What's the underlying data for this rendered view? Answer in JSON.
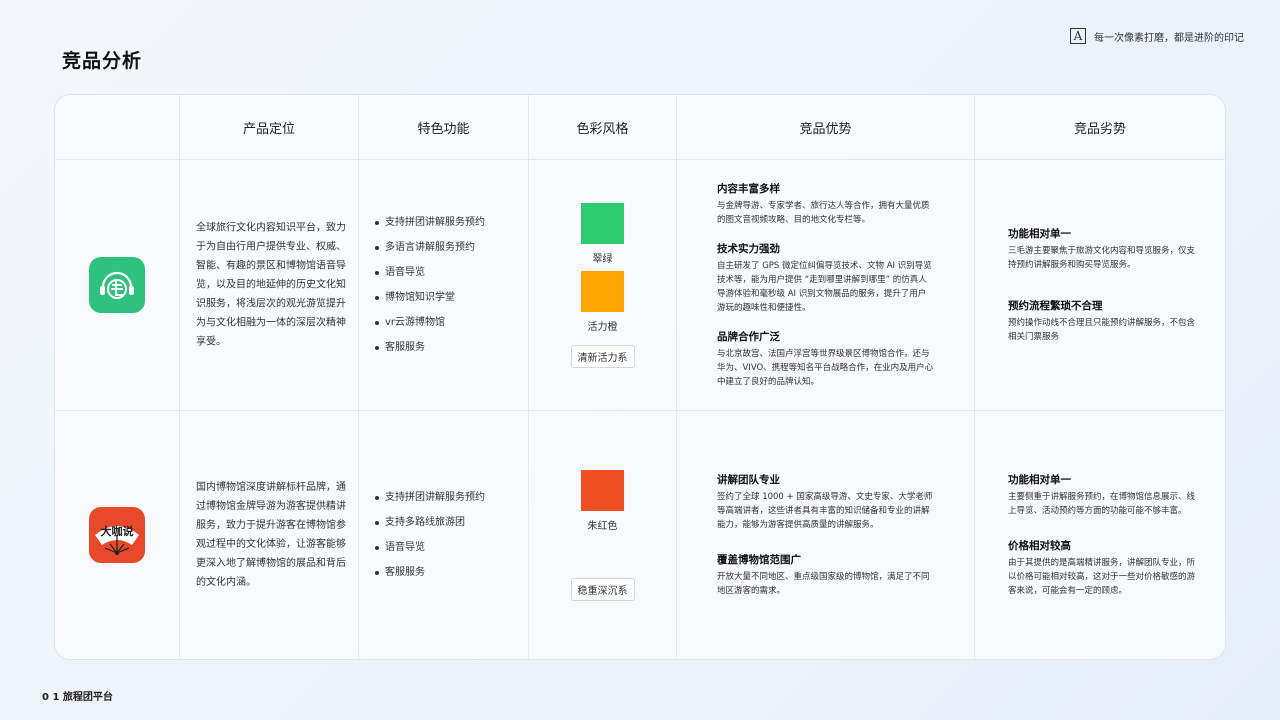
{
  "page": {
    "title": "竞品分析",
    "slogan": "每一次像素打磨，都是进阶的印记",
    "slogan_icon": "A",
    "footer": "0 1 旅程团平台"
  },
  "table": {
    "headers": [
      "产品定位",
      "特色功能",
      "色彩风格",
      "竞品优势",
      "竞品劣势"
    ],
    "rows": [
      {
        "logo_icon": "three-hairs-app-icon",
        "logo_color": "#2ec27e",
        "positioning": "全球旅行文化内容知识平台，致力于为自由行用户提供专业、权威、智能、有趣的景区和博物馆语音导览，以及目的地延伸的历史文化知识服务，将浅层次的观光游览提升为与文化相融为一体的深层次精神享受。",
        "features": [
          "支持拼团讲解服务预约",
          "多语言讲解服务预约",
          "语音导览",
          "博物馆知识学堂",
          "vr云游博物馆",
          "客服服务"
        ],
        "colors": [
          {
            "name": "翠绿",
            "hex": "#2ecc71"
          },
          {
            "name": "活力橙",
            "hex": "#ffa502"
          }
        ],
        "color_style": "清新活力系",
        "advantages": [
          {
            "title": "内容丰富多样",
            "text": "与金牌导游、专家学者、旅行达人等合作，拥有大量优质的图文音视频攻略、目的地文化专栏等。"
          },
          {
            "title": "技术实力强劲",
            "text": "自主研发了 GPS 微定位纠偏导览技术、文物 AI 识别导览技术等，能为用户提供 “走到哪里讲解到哪里” 的仿真人导游体验和毫秒级 AI 识别文物展品的服务，提升了用户游玩的趣味性和便捷性。"
          },
          {
            "title": "品牌合作广泛",
            "text": "与北京故宫、法国卢浮宫等世界级景区博物馆合作，还与华为、VIVO、携程等知名平台战略合作，在业内及用户心中建立了良好的品牌认知。"
          }
        ],
        "disadvantages": [
          {
            "title": "功能相对单一",
            "text": "三毛游主要聚焦于旅游文化内容和导览服务，仅支持预约讲解服务和购买导览服务。"
          },
          {
            "title": "预约流程繁琐不合理",
            "text": "预约操作动线不合理且只能预约讲解服务，不包含相关门票服务"
          }
        ]
      },
      {
        "logo_icon": "dakashuo-fan-icon",
        "logo_color": "#e8492b",
        "logo_text": "大咖说",
        "positioning": "国内博物馆深度讲解标杆品牌，通过博物馆金牌导游为游客提供精讲服务，致力于提升游客在博物馆参观过程中的文化体验，让游客能够更深入地了解博物馆的展品和背后的文化内涵。",
        "features": [
          "支持拼团讲解服务预约",
          "支持多路线旅游团",
          "语音导览",
          "客服服务"
        ],
        "colors": [
          {
            "name": "朱红色",
            "hex": "#f04e23"
          }
        ],
        "color_style": "稳重深沉系",
        "advantages": [
          {
            "title": "讲解团队专业",
            "text": "签约了全球 1000 + 国家高级导游、文史专家、大学老师等高端讲者，这些讲者具有丰富的知识储备和专业的讲解能力，能够为游客提供高质量的讲解服务。"
          },
          {
            "title": "覆盖博物馆范围广",
            "text": "开放大量不同地区、重点级国家级的博物馆，满足了不同地区游客的需求。"
          }
        ],
        "disadvantages": [
          {
            "title": "功能相对单一",
            "text": "主要侧重于讲解服务预约，在博物馆信息展示、线上导览、活动预约等方面的功能可能不够丰富。"
          },
          {
            "title": "价格相对较高",
            "text": "由于其提供的是高端精讲服务，讲解团队专业，所以价格可能相对较高，这对于一些对价格敏感的游客来说，可能会有一定的顾虑。"
          }
        ]
      }
    ]
  }
}
